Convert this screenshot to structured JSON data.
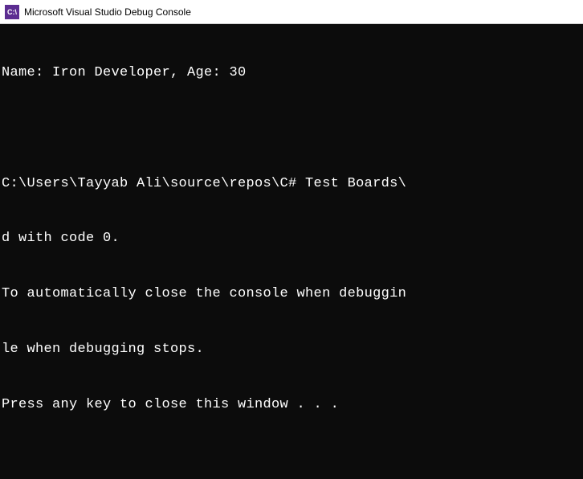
{
  "window": {
    "title": "Microsoft Visual Studio Debug Console",
    "icon_text": "C:\\"
  },
  "console": {
    "lines": [
      "Name: Iron Developer, Age: 30",
      "",
      "C:\\Users\\Tayyab Ali\\source\\repos\\C# Test Boards\\",
      "d with code 0.",
      "To automatically close the console when debuggin",
      "le when debugging stops.",
      "Press any key to close this window . . ."
    ]
  }
}
